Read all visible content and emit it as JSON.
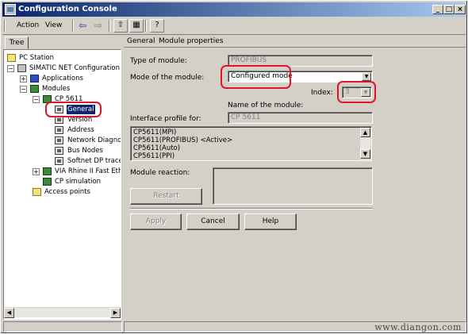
{
  "window": {
    "title": "Configuration Console"
  },
  "menu": {
    "action": "Action",
    "view": "View"
  },
  "tree": {
    "tab_label": "Tree",
    "nodes": {
      "pc_station": "PC Station",
      "simatic": "SIMATIC NET Configuration",
      "applications": "Applications",
      "modules": "Modules",
      "cp5611": "CP 5611",
      "general": "General",
      "version": "Version",
      "address": "Address",
      "network_diag": "Network Diagnos",
      "bus_nodes": "Bus Nodes",
      "softnet": "Softnet DP trace",
      "via_rhine": "VIA Rhine II Fast Eth",
      "cp_sim": "CP simulation",
      "access_points": "Access points"
    }
  },
  "header": {
    "general": "General",
    "module_properties": "Module properties"
  },
  "form": {
    "type_label": "Type of module:",
    "type_value": "PROFIBUS",
    "mode_label": "Mode of the module:",
    "mode_value": "Configured mode",
    "index_label": "Index:",
    "index_value": "3",
    "name_label": "Name of the module:",
    "interface_label": "Interface profile for:",
    "name_value": "CP 5611",
    "profiles": [
      "CP5611(MPI)",
      "CP5611(PROFIBUS) <Active>",
      "CP5611(Auto)",
      "CP5611(PPI)"
    ],
    "reaction_label": "Module reaction:",
    "restart_button": "Restart"
  },
  "buttons": {
    "apply": "Apply",
    "cancel": "Cancel",
    "help": "Help"
  },
  "status": {
    "watermark": "www.diangon.com"
  },
  "colors": {
    "title_start": "#0a246a",
    "title_end": "#a6caf0",
    "highlight": "#e0142a",
    "face": "#d4d0c8"
  }
}
